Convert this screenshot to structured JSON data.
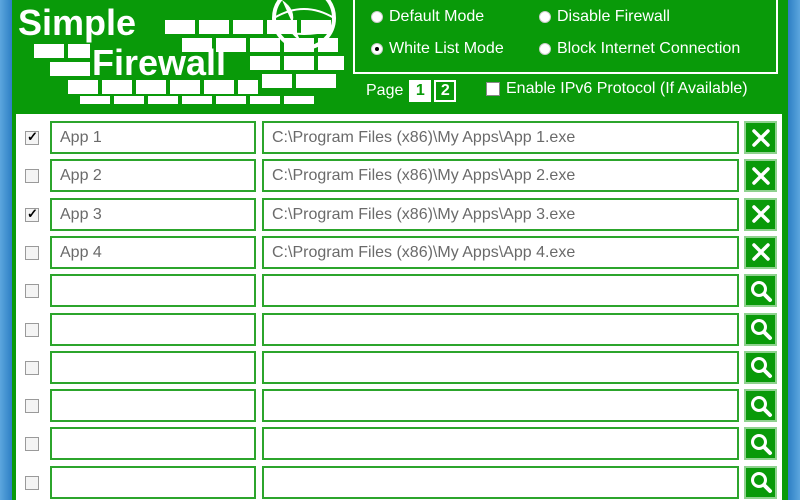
{
  "logo": {
    "line1": "Simple",
    "line2": "Firewall"
  },
  "modes": [
    {
      "label": "Default Mode",
      "selected": false
    },
    {
      "label": "Disable Firewall",
      "selected": false
    },
    {
      "label": "White List Mode",
      "selected": true
    },
    {
      "label": "Block Internet Connection",
      "selected": false
    }
  ],
  "pagination": {
    "label": "Page",
    "pages": [
      "1",
      "2"
    ],
    "current": "1"
  },
  "ipv6": {
    "label": "Enable IPv6 Protocol (If Available)",
    "checked": false
  },
  "rows": [
    {
      "checked": true,
      "name": "App 1",
      "path": "C:\\Program Files (x86)\\My Apps\\App 1.exe",
      "action": "remove"
    },
    {
      "checked": false,
      "name": "App 2",
      "path": "C:\\Program Files (x86)\\My Apps\\App 2.exe",
      "action": "remove"
    },
    {
      "checked": true,
      "name": "App 3",
      "path": "C:\\Program Files (x86)\\My Apps\\App 3.exe",
      "action": "remove"
    },
    {
      "checked": false,
      "name": "App 4",
      "path": "C:\\Program Files (x86)\\My Apps\\App 4.exe",
      "action": "remove"
    },
    {
      "checked": false,
      "name": "",
      "path": "",
      "action": "browse"
    },
    {
      "checked": false,
      "name": "",
      "path": "",
      "action": "browse"
    },
    {
      "checked": false,
      "name": "",
      "path": "",
      "action": "browse"
    },
    {
      "checked": false,
      "name": "",
      "path": "",
      "action": "browse"
    },
    {
      "checked": false,
      "name": "",
      "path": "",
      "action": "browse"
    },
    {
      "checked": false,
      "name": "",
      "path": "",
      "action": "browse"
    }
  ],
  "colors": {
    "app_green": "#099a09",
    "field_border": "#2ca52c",
    "button_border": "#8fd28f",
    "window_frame": "#3a8fd0"
  }
}
